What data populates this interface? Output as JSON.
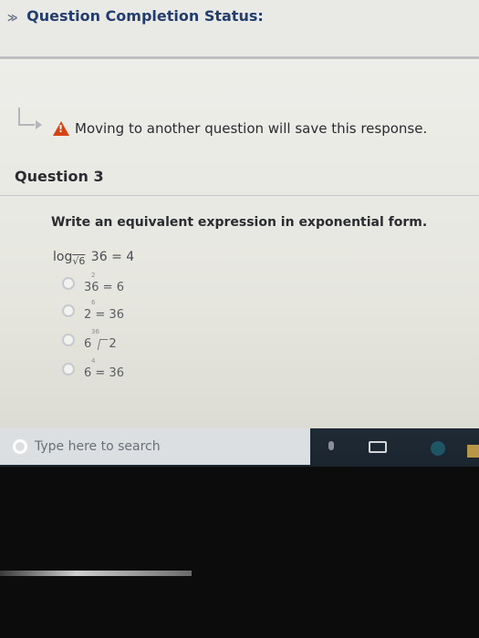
{
  "status": {
    "title": "Question Completion Status:",
    "chevron": "≫"
  },
  "notice": {
    "warning_icon": "warning-icon",
    "text": "Moving to another question will save this response."
  },
  "question": {
    "title": "Question 3",
    "prompt": "Write an equivalent expression in exponential form.",
    "expression": {
      "log": "log",
      "base": "√6",
      "rest": " 36 = 4"
    },
    "options": [
      {
        "text": "36  = 6",
        "sup": "2"
      },
      {
        "text": "2  = 36",
        "sup": "6"
      },
      {
        "text": "6",
        "text2": "2",
        "sup": "36"
      },
      {
        "text": "6  = 36",
        "sup": "4"
      }
    ]
  },
  "taskbar": {
    "search_placeholder": "Type here to search",
    "search_icon": "cortana-ring-icon",
    "mic_icon": "mic-icon",
    "task_view_icon": "task-view-icon"
  },
  "colors": {
    "title": "#233d6e",
    "warning": "#d84315",
    "taskbar": "#1f2a35"
  }
}
